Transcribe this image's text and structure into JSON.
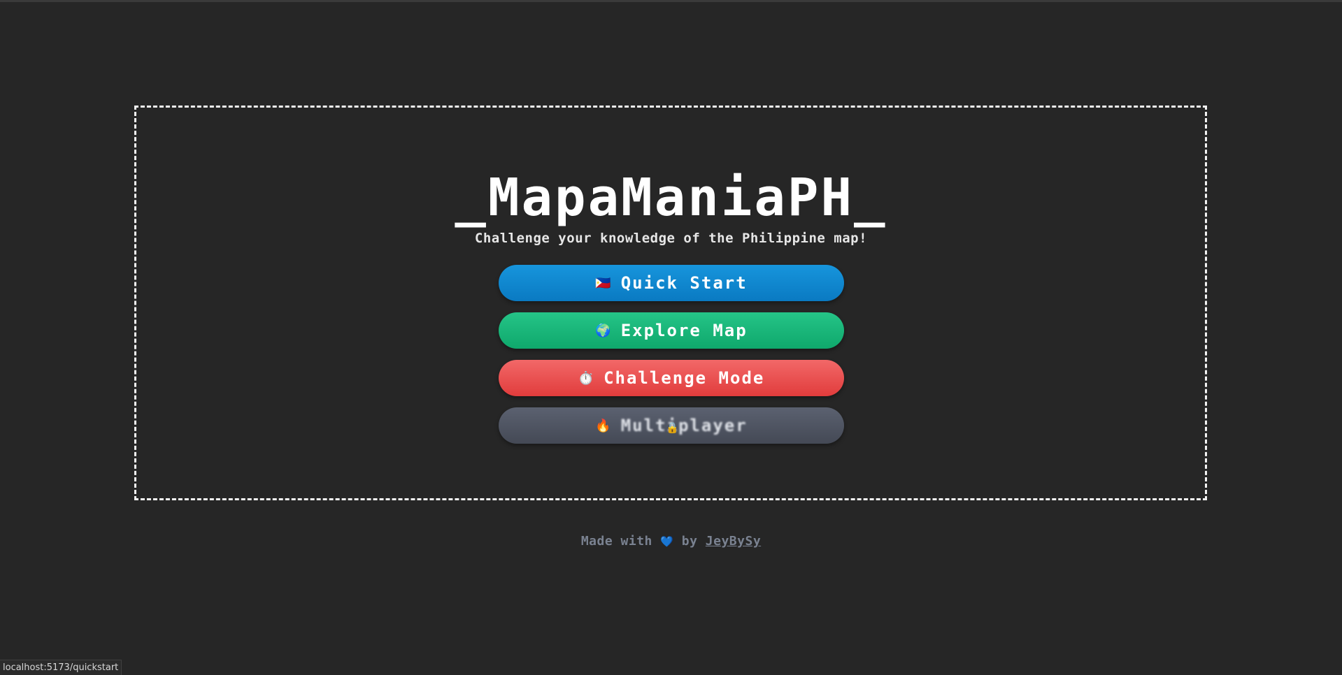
{
  "app": {
    "title": "_MapaManiaPH_",
    "subtitle": "Challenge your knowledge of the Philippine map!"
  },
  "menu": {
    "quick_start": {
      "icon": "🇵🇭",
      "label": "Quick Start",
      "color": "#0a86cf"
    },
    "explore_map": {
      "icon": "🌍",
      "label": "Explore Map",
      "color": "#16b67a"
    },
    "challenge_mode": {
      "icon": "⏱️",
      "label": "Challenge Mode",
      "color": "#ea4f4f"
    },
    "multiplayer": {
      "icon": "🔥",
      "label": "Multiplayer",
      "locked_icon": "🔒",
      "color": "#4f5461",
      "locked": true
    }
  },
  "footer": {
    "prefix": "Made with",
    "heart": "💙",
    "by": "by",
    "author": "JeyBySy"
  },
  "status_bar": {
    "url": "localhost:5173/quickstart"
  }
}
